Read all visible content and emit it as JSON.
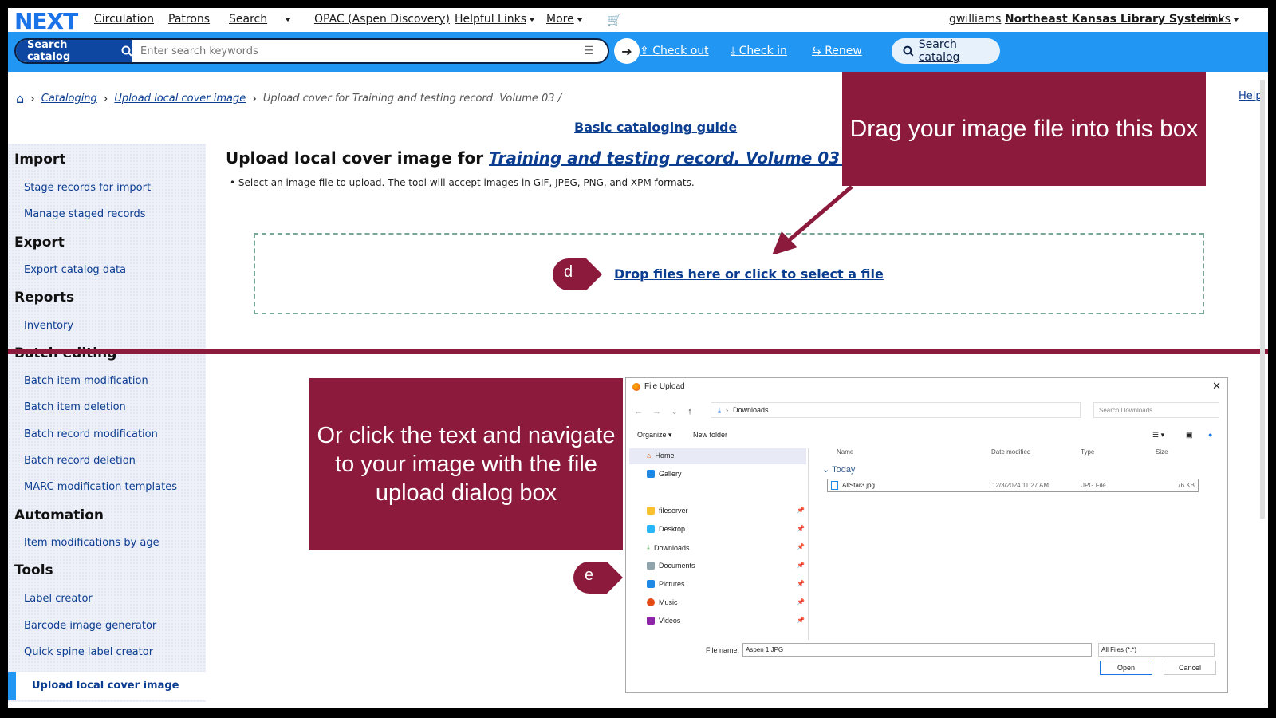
{
  "app": {
    "logo": "NEXT"
  },
  "topnav": {
    "circulation": "Circulation",
    "patrons": "Patrons",
    "search": "Search",
    "opac": "OPAC (Aspen Discovery)",
    "helpful_links": "Helpful Links",
    "more": "More",
    "user": "gwilliams",
    "library": "Northeast Kansas Library System",
    "links": "Links"
  },
  "searchbar": {
    "button_label": "Search catalog",
    "placeholder": "Enter search keywords",
    "check_out": "Check out",
    "check_in": "Check in",
    "renew": "Renew",
    "search_catalog": "Search catalog"
  },
  "breadcrumb": {
    "items": [
      "Cataloging",
      "Upload local cover image"
    ],
    "current": "Upload cover for Training and testing record. Volume 03 /"
  },
  "help": "Help",
  "guide": "Basic cataloging guide",
  "sidebar": {
    "import": {
      "title": "Import",
      "items": [
        "Stage records for import",
        "Manage staged records"
      ]
    },
    "export": {
      "title": "Export",
      "items": [
        "Export catalog data"
      ]
    },
    "reports": {
      "title": "Reports",
      "items": [
        "Inventory"
      ]
    },
    "batch": {
      "title": "Batch editing",
      "items": [
        "Batch item modification",
        "Batch item deletion",
        "Batch record modification",
        "Batch record deletion",
        "MARC modification templates"
      ]
    },
    "automation": {
      "title": "Automation",
      "items": [
        "Item modifications by age"
      ]
    },
    "tools": {
      "title": "Tools",
      "items": [
        "Label creator",
        "Barcode image generator",
        "Quick spine label creator"
      ]
    },
    "active": "Upload local cover image"
  },
  "main": {
    "title_prefix": "Upload local cover image for",
    "title_link": "Training and testing record. Volume 03 /",
    "instruction": "Select an image file to upload. The tool will accept images in GIF, JPEG, PNG, and XPM formats.",
    "drop_text": "Drop files here or click to select a file"
  },
  "callouts": {
    "drag": "Drag your image file into this box",
    "click": "Or click the text and navigate to your image with the file upload dialog box",
    "marker_d": "d",
    "marker_e": "e"
  },
  "dialog": {
    "title": "File Upload",
    "address": "Downloads",
    "search_placeholder": "Search Downloads",
    "organize": "Organize",
    "new_folder": "New folder",
    "tree": [
      "Home",
      "Gallery",
      "fileserver",
      "Desktop",
      "Downloads",
      "Documents",
      "Pictures",
      "Music",
      "Videos"
    ],
    "columns": {
      "name": "Name",
      "date": "Date modified",
      "type": "Type",
      "size": "Size"
    },
    "group": "Today",
    "file": {
      "name": "AllStar3.jpg",
      "date": "12/3/2024 11:27 AM",
      "type": "JPG File",
      "size": "76 KB"
    },
    "file_name_label": "File name:",
    "file_name_value": "Aspen 1.JPG",
    "file_type": "All Files (*.*)",
    "open": "Open",
    "cancel": "Cancel"
  },
  "colors": {
    "accent": "#2196f3",
    "brand_dark": "#0d47a1",
    "callout": "#8b1a3c",
    "link": "#0b3d91"
  }
}
